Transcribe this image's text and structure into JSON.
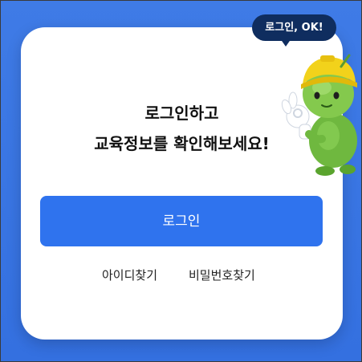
{
  "card": {
    "headline_line1": "로그인하고",
    "headline_line2": "교육정보를 확인해보세요!",
    "login_button": "로그인",
    "find_id_link": "아이디찾기",
    "find_password_link": "비밀번호찾기"
  },
  "mascot": {
    "speech_bubble": "로그인, OK!",
    "icon": "green-robot-mascot-icon"
  },
  "colors": {
    "background": "#3f7be6",
    "primary_button": "#2f73ee",
    "bubble": "#0f2d5f",
    "mascot_green": "#7cc24a",
    "mascot_helmet": "#f2d21b"
  }
}
